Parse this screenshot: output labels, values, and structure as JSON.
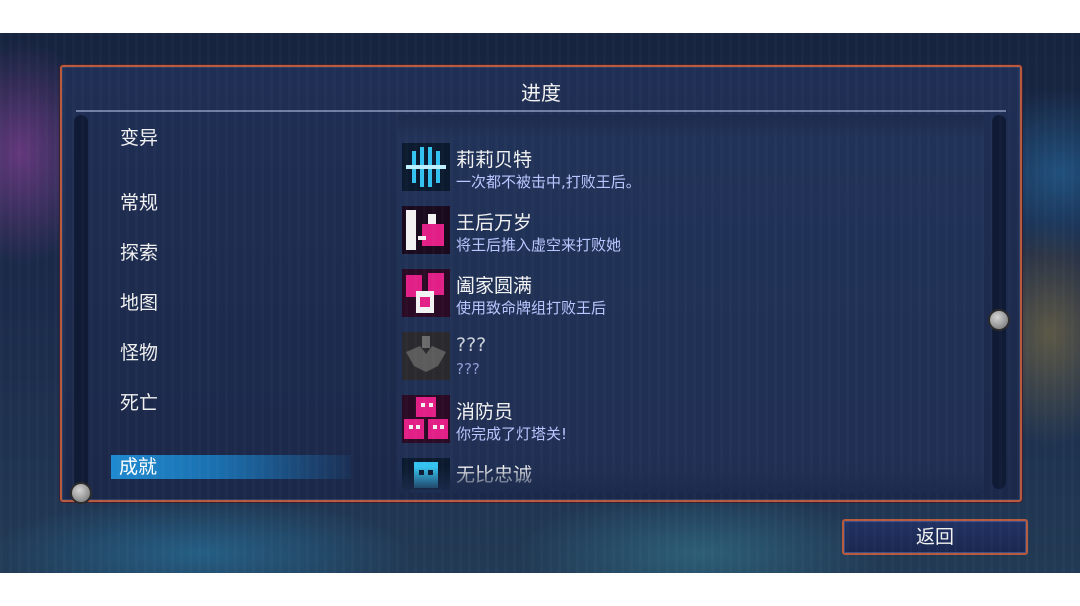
{
  "panel": {
    "title": "进度"
  },
  "categories": [
    {
      "label": "变异",
      "selected": false
    },
    {
      "label": "常规",
      "selected": false
    },
    {
      "label": "探索",
      "selected": false
    },
    {
      "label": "地图",
      "selected": false
    },
    {
      "label": "怪物",
      "selected": false
    },
    {
      "label": "死亡",
      "selected": false
    },
    {
      "label": "成就",
      "selected": true
    }
  ],
  "achievements": [
    {
      "name": "莉莉贝特",
      "desc": "一次都不被击中,打败王后。",
      "icon": "lightning-sword-icon",
      "color": "#34c3f0",
      "locked": false
    },
    {
      "name": "王后万岁",
      "desc": "将王后推入虚空来打败她",
      "icon": "queen-push-icon",
      "color": "#e21f86",
      "locked": false
    },
    {
      "name": "阖家圆满",
      "desc": "使用致命牌组打败王后",
      "icon": "card-deck-icon",
      "color": "#e21f86",
      "locked": false
    },
    {
      "name": "???",
      "desc": "???",
      "icon": "locked-winged-icon",
      "color": "#5b5b5b",
      "locked": true
    },
    {
      "name": "消防员",
      "desc": "你完成了灯塔关!",
      "icon": "masks-icon",
      "color": "#e21f86",
      "locked": false
    },
    {
      "name": "无比忠诚",
      "desc": "",
      "icon": "mask-icon",
      "color": "#34c3f0",
      "locked": false
    }
  ],
  "buttons": {
    "back": "返回"
  }
}
